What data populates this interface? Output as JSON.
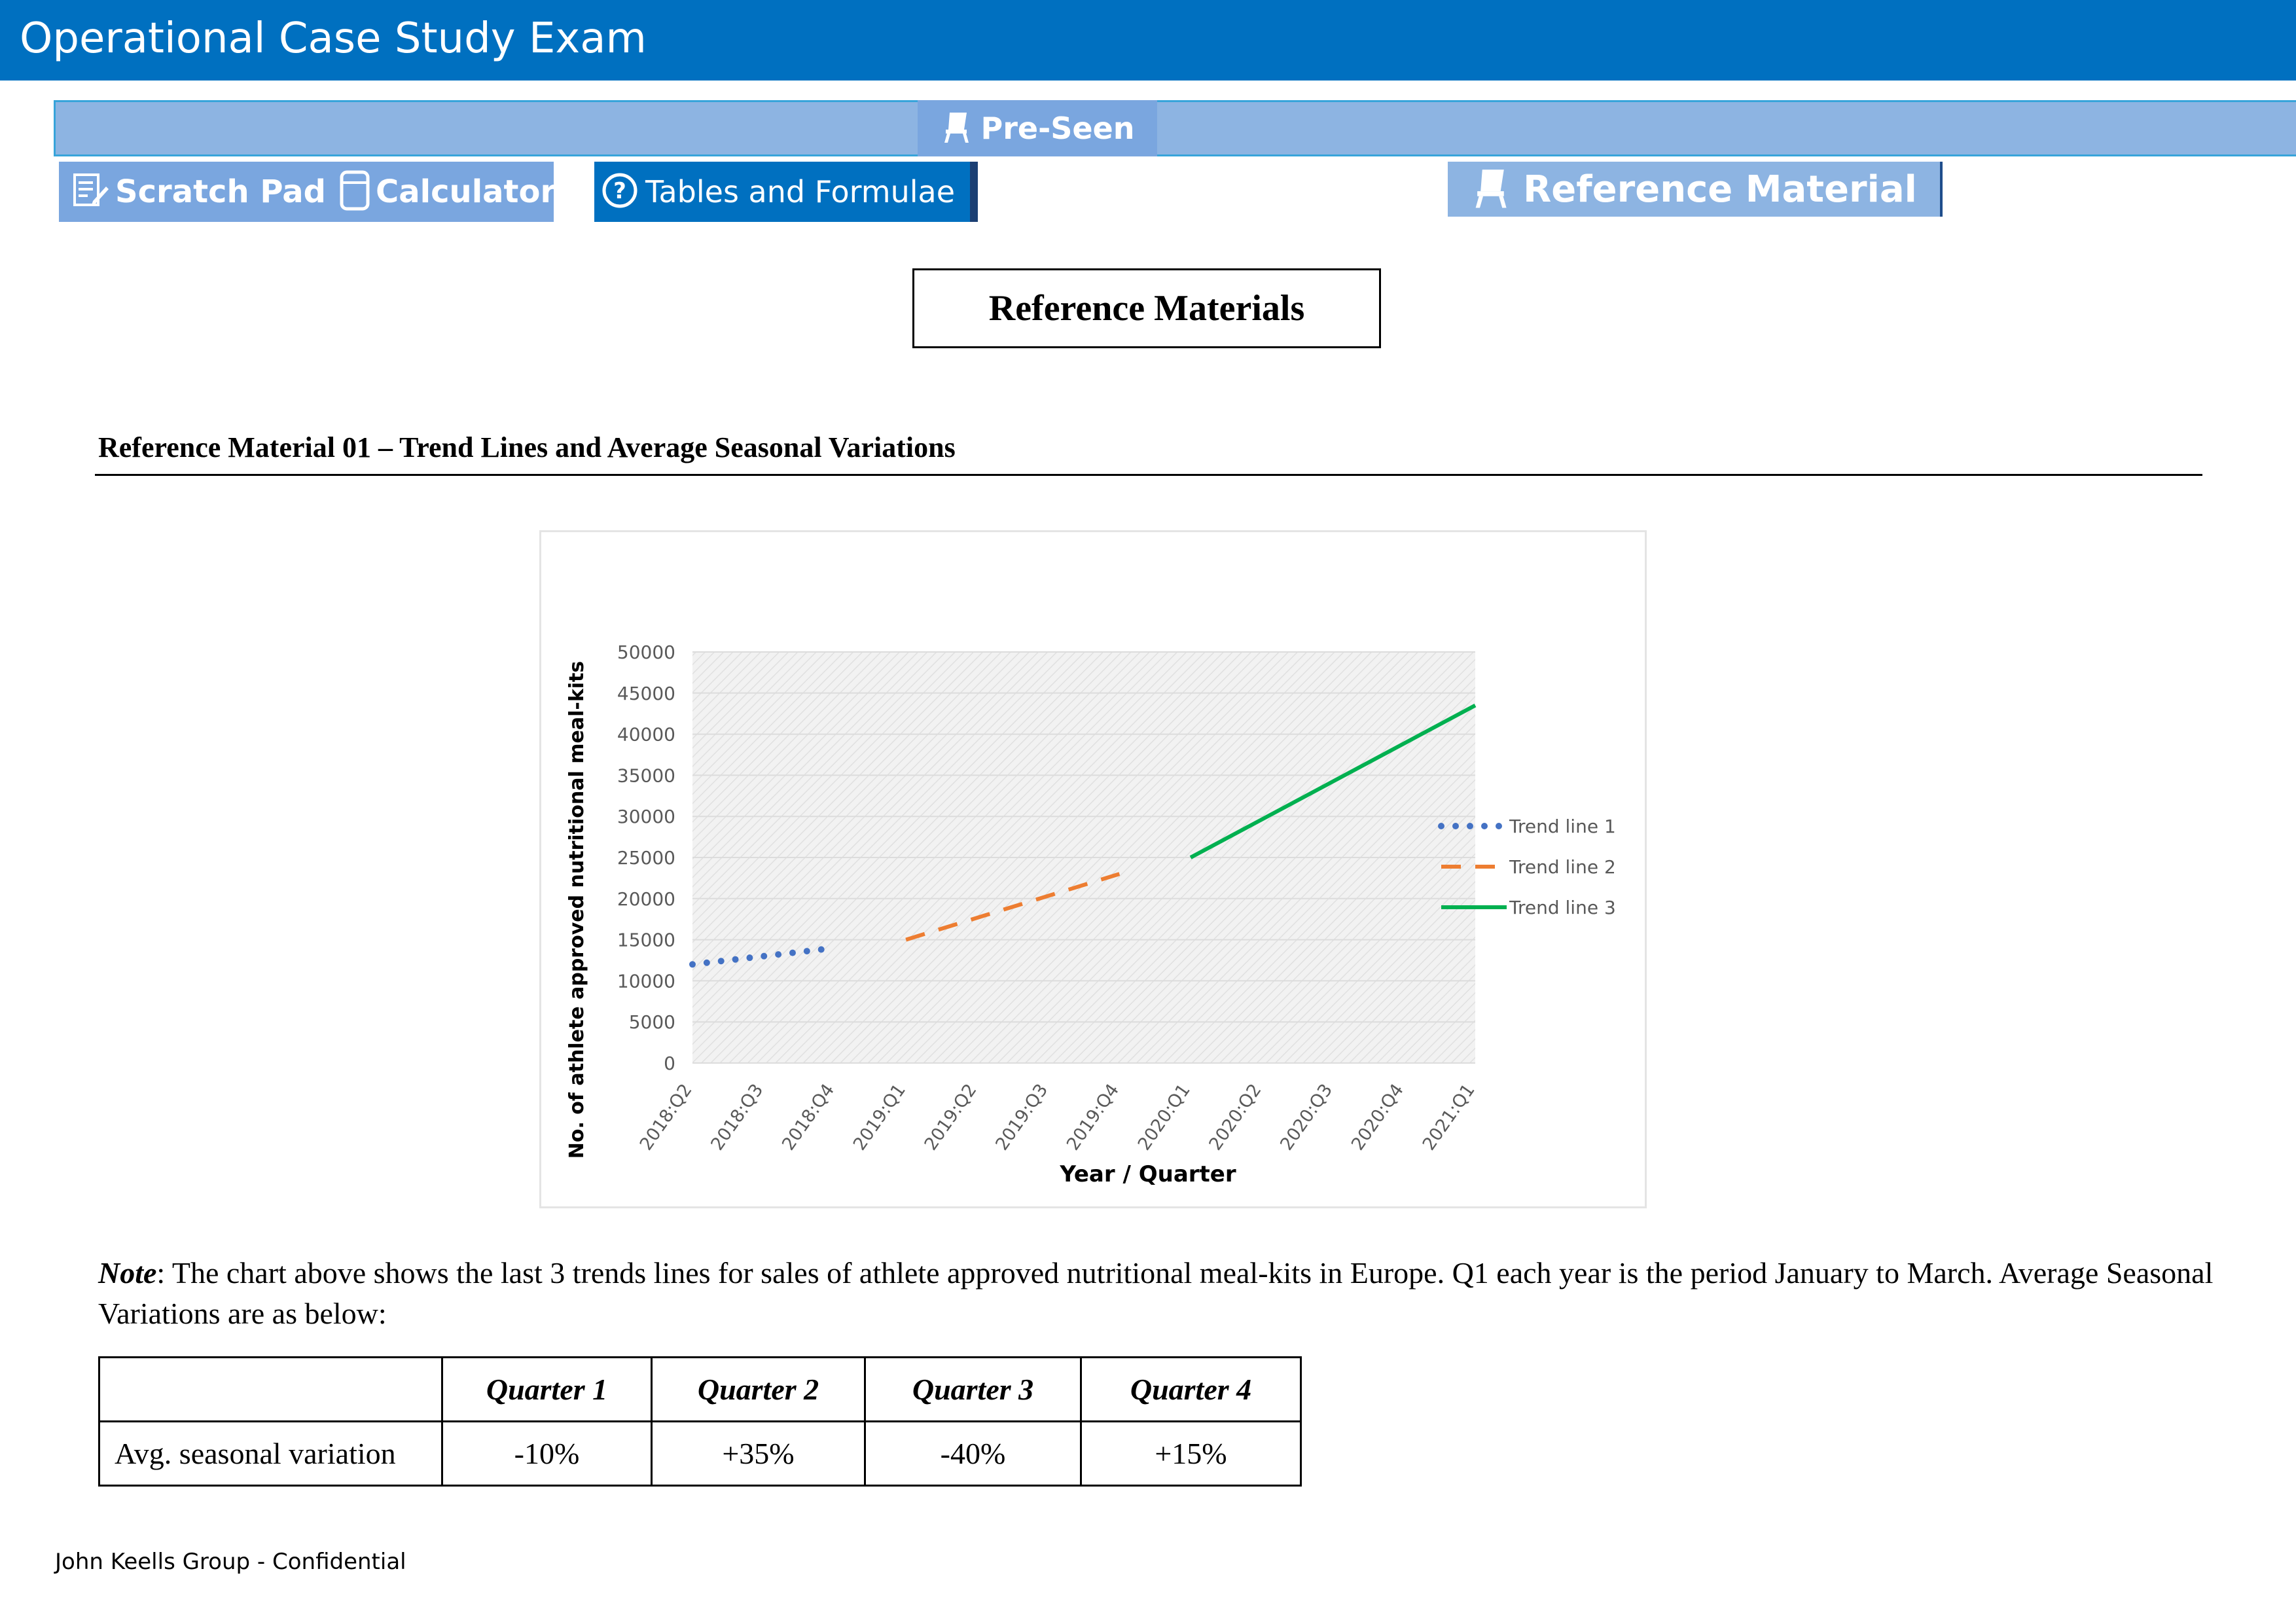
{
  "app": {
    "title": "Operational Case Study Exam"
  },
  "toolbar": {
    "preseen_label": "Pre-Seen",
    "scratch_pad_label": "Scratch Pad",
    "calculator_label": "Calculator",
    "tables_label": "Tables and Formulae",
    "reference_label": "Reference Material",
    "accent_color": "#0070c0",
    "light_color": "#8db4e2"
  },
  "page": {
    "heading": "Reference Materials",
    "section_title": "Reference Material 01 – Trend Lines and Average Seasonal Variations",
    "note_label": "Note",
    "note_text": ": The chart above shows the last 3 trends lines for sales of athlete approved nutritional meal-kits in Europe. Q1 each year is the period January to March. Average Seasonal Variations are as below:",
    "footer": "John Keells Group - Confidential"
  },
  "seasonal_table": {
    "headers": [
      "",
      "Quarter 1",
      "Quarter 2",
      "Quarter 3",
      "Quarter 4"
    ],
    "rows": [
      [
        "Avg. seasonal variation",
        "-10%",
        "+35%",
        "-40%",
        "+15%"
      ]
    ]
  },
  "chart_data": {
    "type": "line",
    "title": "",
    "xlabel": "Year / Quarter",
    "ylabel": "No. of athlete approved nutritional meal-kits",
    "ylim": [
      0,
      50000
    ],
    "yticks": [
      0,
      5000,
      10000,
      15000,
      20000,
      25000,
      30000,
      35000,
      40000,
      45000,
      50000
    ],
    "categories": [
      "2018:Q2",
      "2018:Q3",
      "2018:Q4",
      "2019:Q1",
      "2019:Q2",
      "2019:Q3",
      "2019:Q4",
      "2020:Q1",
      "2020:Q2",
      "2020:Q3",
      "2020:Q4",
      "2021:Q1"
    ],
    "grid": true,
    "legend_position": "right",
    "series": [
      {
        "name": "Trend line 1",
        "style": "dotted",
        "color": "#4472c4",
        "x": [
          "2018:Q2",
          "2018:Q4"
        ],
        "y": [
          12000,
          14000
        ]
      },
      {
        "name": "Trend line 2",
        "style": "dashed",
        "color": "#ed7d31",
        "x": [
          "2019:Q1",
          "2019:Q4"
        ],
        "y": [
          15000,
          23000
        ]
      },
      {
        "name": "Trend line 3",
        "style": "solid",
        "color": "#00b050",
        "x": [
          "2020:Q1",
          "2021:Q1"
        ],
        "y": [
          25000,
          43500
        ]
      }
    ]
  }
}
